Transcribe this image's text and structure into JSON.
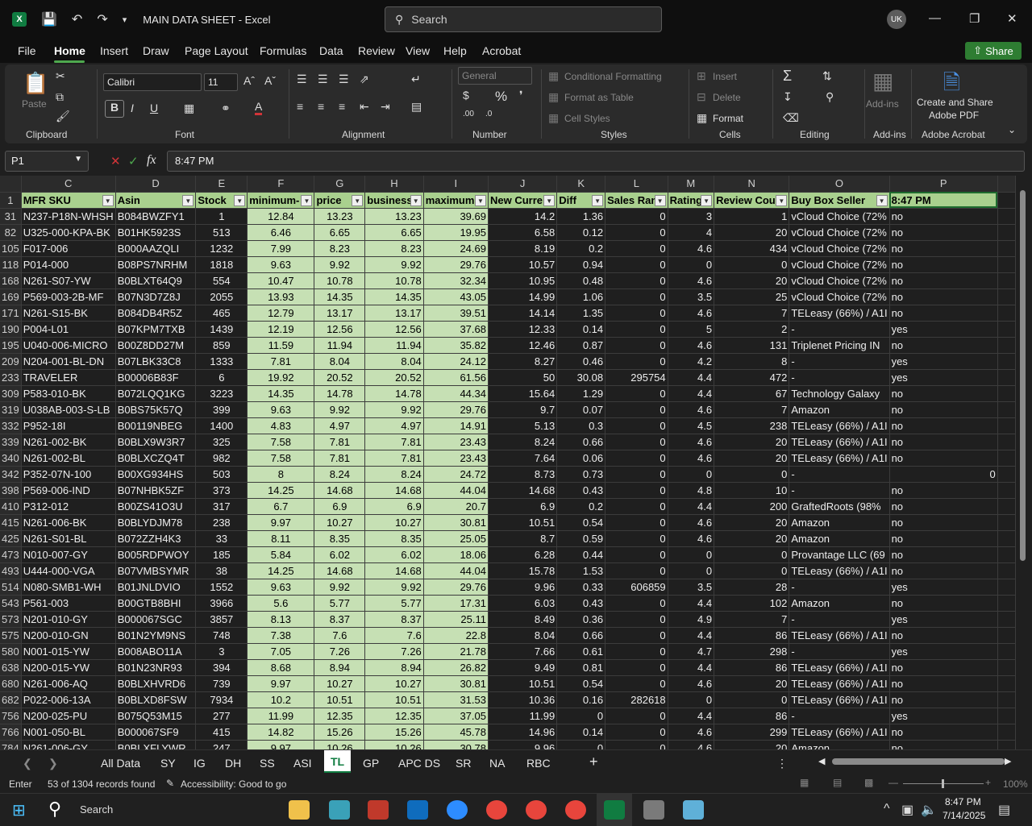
{
  "titlebar": {
    "app_icon": "X",
    "title": "MAIN DATA SHEET  -  Excel",
    "search_placeholder": "Search",
    "avatar_initials": "UK"
  },
  "menu": {
    "tabs": [
      "File",
      "Home",
      "Insert",
      "Draw",
      "Page Layout",
      "Formulas",
      "Data",
      "Review",
      "View",
      "Help",
      "Acrobat"
    ],
    "active": "Home",
    "share_label": "Share"
  },
  "ribbon": {
    "clipboard": {
      "paste": "Paste",
      "label": "Clipboard"
    },
    "font": {
      "name": "Calibri",
      "size": "11",
      "label": "Font"
    },
    "alignment": {
      "label": "Alignment"
    },
    "number": {
      "format": "General",
      "label": "Number"
    },
    "styles": {
      "conditional": "Conditional Formatting",
      "format_table": "Format as Table",
      "cell_styles": "Cell Styles",
      "label": "Styles"
    },
    "cells": {
      "insert": "Insert",
      "delete": "Delete",
      "format": "Format",
      "label": "Cells"
    },
    "editing": {
      "label": "Editing"
    },
    "addins": {
      "addins": "Add-ins",
      "label": "Add-ins"
    },
    "acrobat": {
      "create": "Create and Share",
      "create2": "Adobe PDF",
      "label": "Adobe Acrobat"
    }
  },
  "formula_bar": {
    "name_box": "P1",
    "fx": "fx",
    "content": "8:47 PM"
  },
  "grid": {
    "columns": [
      "C",
      "D",
      "E",
      "F",
      "G",
      "H",
      "I",
      "J",
      "K",
      "L",
      "M",
      "N",
      "O",
      "P"
    ],
    "header_row_num": "1",
    "headers": [
      "MFR SKU",
      "Asin",
      "Stock",
      "minimum-",
      "price",
      "business",
      "maximum",
      "New Curre",
      "Diff",
      "Sales Ran",
      "Rating",
      "Review Cou",
      "Buy Box Seller",
      "8:47 PM"
    ],
    "rows": [
      [
        "31",
        "N237-P18N-WHSH",
        "B084BWZFY1",
        "1",
        "12.84",
        "13.23",
        "13.23",
        "39.69",
        "14.2",
        "1.36",
        "0",
        "3",
        "1",
        "vCloud Choice (72%",
        "no"
      ],
      [
        "82",
        "U325-000-KPA-BK",
        "B01HK5923S",
        "513",
        "6.46",
        "6.65",
        "6.65",
        "19.95",
        "6.58",
        "0.12",
        "0",
        "4",
        "20",
        "vCloud Choice (72%",
        "no"
      ],
      [
        "105",
        "F017-006",
        "B000AAZQLI",
        "1232",
        "7.99",
        "8.23",
        "8.23",
        "24.69",
        "8.19",
        "0.2",
        "0",
        "4.6",
        "434",
        "vCloud Choice (72%",
        "no"
      ],
      [
        "118",
        "P014-000",
        "B08PS7NRHM",
        "1818",
        "9.63",
        "9.92",
        "9.92",
        "29.76",
        "10.57",
        "0.94",
        "0",
        "0",
        "0",
        "vCloud Choice (72%",
        "no"
      ],
      [
        "168",
        "N261-S07-YW",
        "B0BLXT64Q9",
        "554",
        "10.47",
        "10.78",
        "10.78",
        "32.34",
        "10.95",
        "0.48",
        "0",
        "4.6",
        "20",
        "vCloud Choice (72%",
        "no"
      ],
      [
        "169",
        "P569-003-2B-MF",
        "B07N3D7Z8J",
        "2055",
        "13.93",
        "14.35",
        "14.35",
        "43.05",
        "14.99",
        "1.06",
        "0",
        "3.5",
        "25",
        "vCloud Choice (72%",
        "no"
      ],
      [
        "171",
        "N261-S15-BK",
        "B084DB4R5Z",
        "465",
        "12.79",
        "13.17",
        "13.17",
        "39.51",
        "14.14",
        "1.35",
        "0",
        "4.6",
        "7",
        "TELeasy (66%) / A1I",
        "no"
      ],
      [
        "190",
        "P004-L01",
        "B07KPM7TXB",
        "1439",
        "12.19",
        "12.56",
        "12.56",
        "37.68",
        "12.33",
        "0.14",
        "0",
        "5",
        "2",
        "-",
        "yes"
      ],
      [
        "195",
        "U040-006-MICRO",
        "B00Z8DD27M",
        "859",
        "11.59",
        "11.94",
        "11.94",
        "35.82",
        "12.46",
        "0.87",
        "0",
        "4.6",
        "131",
        "Triplenet Pricing IN",
        "no"
      ],
      [
        "209",
        "N204-001-BL-DN",
        "B07LBK33C8",
        "1333",
        "7.81",
        "8.04",
        "8.04",
        "24.12",
        "8.27",
        "0.46",
        "0",
        "4.2",
        "8",
        "-",
        "yes"
      ],
      [
        "233",
        "TRAVELER",
        "B00006B83F",
        "6",
        "19.92",
        "20.52",
        "20.52",
        "61.56",
        "50",
        "30.08",
        "295754",
        "4.4",
        "472",
        "-",
        "yes"
      ],
      [
        "309",
        "P583-010-BK",
        "B072LQQ1KG",
        "3223",
        "14.35",
        "14.78",
        "14.78",
        "44.34",
        "15.64",
        "1.29",
        "0",
        "4.4",
        "67",
        "Technology Galaxy",
        "no"
      ],
      [
        "319",
        "U038AB-003-S-LB",
        "B0BS75K57Q",
        "399",
        "9.63",
        "9.92",
        "9.92",
        "29.76",
        "9.7",
        "0.07",
        "0",
        "4.6",
        "7",
        "Amazon",
        "no"
      ],
      [
        "332",
        "P952-18I",
        "B00119NBEG",
        "1400",
        "4.83",
        "4.97",
        "4.97",
        "14.91",
        "5.13",
        "0.3",
        "0",
        "4.5",
        "238",
        "TELeasy (66%) / A1I",
        "no"
      ],
      [
        "339",
        "N261-002-BK",
        "B0BLX9W3R7",
        "325",
        "7.58",
        "7.81",
        "7.81",
        "23.43",
        "8.24",
        "0.66",
        "0",
        "4.6",
        "20",
        "TELeasy (66%) / A1I",
        "no"
      ],
      [
        "340",
        "N261-002-BL",
        "B0BLXCZQ4T",
        "982",
        "7.58",
        "7.81",
        "7.81",
        "23.43",
        "7.64",
        "0.06",
        "0",
        "4.6",
        "20",
        "TELeasy (66%) / A1I",
        "no"
      ],
      [
        "342",
        "P352-07N-100",
        "B00XG934HS",
        "503",
        "8",
        "8.24",
        "8.24",
        "24.72",
        "8.73",
        "0.73",
        "0",
        "0",
        "0",
        "-",
        "0"
      ],
      [
        "398",
        "P569-006-IND",
        "B07NHBK5ZF",
        "373",
        "14.25",
        "14.68",
        "14.68",
        "44.04",
        "14.68",
        "0.43",
        "0",
        "4.8",
        "10",
        "-",
        "no"
      ],
      [
        "410",
        "P312-012",
        "B00ZS41O3U",
        "317",
        "6.7",
        "6.9",
        "6.9",
        "20.7",
        "6.9",
        "0.2",
        "0",
        "4.4",
        "200",
        "GraftedRoots (98%",
        "no"
      ],
      [
        "415",
        "N261-006-BK",
        "B0BLYDJM78",
        "238",
        "9.97",
        "10.27",
        "10.27",
        "30.81",
        "10.51",
        "0.54",
        "0",
        "4.6",
        "20",
        "Amazon",
        "no"
      ],
      [
        "425",
        "N261-S01-BL",
        "B072ZZH4K3",
        "33",
        "8.11",
        "8.35",
        "8.35",
        "25.05",
        "8.7",
        "0.59",
        "0",
        "4.6",
        "20",
        "Amazon",
        "no"
      ],
      [
        "473",
        "N010-007-GY",
        "B005RDPWOY",
        "185",
        "5.84",
        "6.02",
        "6.02",
        "18.06",
        "6.28",
        "0.44",
        "0",
        "0",
        "0",
        "Provantage LLC (69",
        "no"
      ],
      [
        "493",
        "U444-000-VGA",
        "B07VMBSYMR",
        "38",
        "14.25",
        "14.68",
        "14.68",
        "44.04",
        "15.78",
        "1.53",
        "0",
        "0",
        "0",
        "TELeasy (66%) / A1I",
        "no"
      ],
      [
        "514",
        "N080-SMB1-WH",
        "B01JNLDVIO",
        "1552",
        "9.63",
        "9.92",
        "9.92",
        "29.76",
        "9.96",
        "0.33",
        "606859",
        "3.5",
        "28",
        "-",
        "yes"
      ],
      [
        "543",
        "P561-003",
        "B00GTB8BHI",
        "3966",
        "5.6",
        "5.77",
        "5.77",
        "17.31",
        "6.03",
        "0.43",
        "0",
        "4.4",
        "102",
        "Amazon",
        "no"
      ],
      [
        "573",
        "N201-010-GY",
        "B000067SGC",
        "3857",
        "8.13",
        "8.37",
        "8.37",
        "25.11",
        "8.49",
        "0.36",
        "0",
        "4.9",
        "7",
        "-",
        "yes"
      ],
      [
        "575",
        "N200-010-GN",
        "B01N2YM9NS",
        "748",
        "7.38",
        "7.6",
        "7.6",
        "22.8",
        "8.04",
        "0.66",
        "0",
        "4.4",
        "86",
        "TELeasy (66%) / A1I",
        "no"
      ],
      [
        "580",
        "N001-015-YW",
        "B008ABO11A",
        "3",
        "7.05",
        "7.26",
        "7.26",
        "21.78",
        "7.66",
        "0.61",
        "0",
        "4.7",
        "298",
        "-",
        "yes"
      ],
      [
        "638",
        "N200-015-YW",
        "B01N23NR93",
        "394",
        "8.68",
        "8.94",
        "8.94",
        "26.82",
        "9.49",
        "0.81",
        "0",
        "4.4",
        "86",
        "TELeasy (66%) / A1I",
        "no"
      ],
      [
        "680",
        "N261-006-AQ",
        "B0BLXHVRD6",
        "739",
        "9.97",
        "10.27",
        "10.27",
        "30.81",
        "10.51",
        "0.54",
        "0",
        "4.6",
        "20",
        "TELeasy (66%) / A1I",
        "no"
      ],
      [
        "682",
        "P022-006-13A",
        "B0BLXD8FSW",
        "7934",
        "10.2",
        "10.51",
        "10.51",
        "31.53",
        "10.36",
        "0.16",
        "282618",
        "0",
        "0",
        "TELeasy (66%) / A1I",
        "no"
      ],
      [
        "756",
        "N200-025-PU",
        "B075Q53M15",
        "277",
        "11.99",
        "12.35",
        "12.35",
        "37.05",
        "11.99",
        "0",
        "0",
        "4.4",
        "86",
        "-",
        "yes"
      ],
      [
        "766",
        "N001-050-BL",
        "B000067SF9",
        "415",
        "14.82",
        "15.26",
        "15.26",
        "45.78",
        "14.96",
        "0.14",
        "0",
        "4.6",
        "299",
        "TELeasy (66%) / A1I",
        "no"
      ],
      [
        "784",
        "N261-006-GY",
        "B0BLXFLYWR",
        "247",
        "9.97",
        "10.26",
        "10.26",
        "30.78",
        "9.96",
        "0",
        "0",
        "4.6",
        "20",
        "Amazon",
        "no"
      ]
    ]
  },
  "sheet_tabs": [
    "All Data",
    "SY",
    "IG",
    "DH",
    "SS",
    "ASI",
    "TL",
    "GP",
    "APC DS",
    "SR",
    "NA",
    "RBC"
  ],
  "active_sheet": "TL",
  "status": {
    "mode": "Enter",
    "records": "53 of 1304 records found",
    "accessibility": "Accessibility: Good to go",
    "zoom": "100%"
  },
  "taskbar": {
    "search": "Search",
    "time": "8:47 PM",
    "date": "7/14/2025"
  },
  "colors": {
    "accent_green": "#107c41",
    "header_fill": "#a9d08e",
    "highlight_fill": "#c6e0b4"
  }
}
